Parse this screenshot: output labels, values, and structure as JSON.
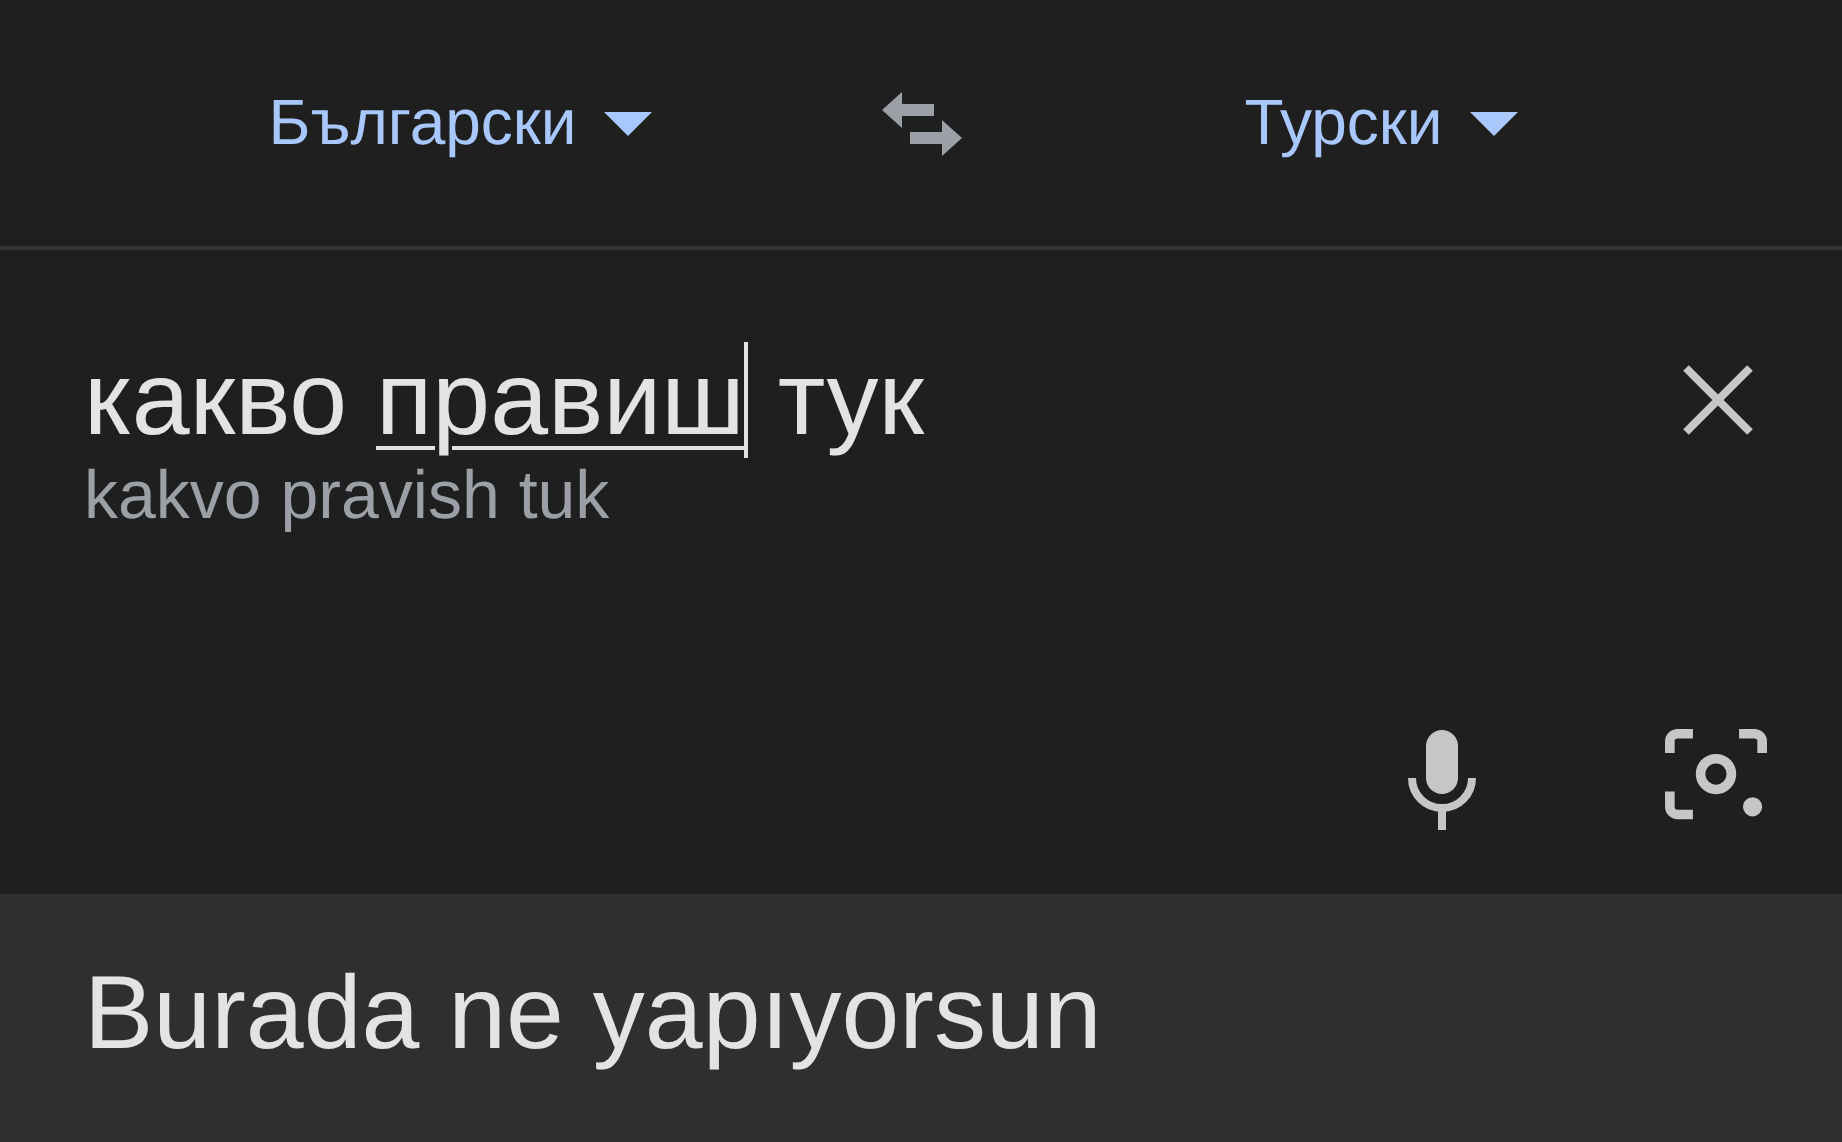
{
  "language_bar": {
    "source": {
      "label": "Български"
    },
    "target": {
      "label": "Турски"
    }
  },
  "input": {
    "text_before": "какво ",
    "composing_text": "правиш",
    "text_after": " тук",
    "transliteration": "kakvo pravish tuk"
  },
  "output": {
    "text": "Burada ne yapıyorsun"
  }
}
